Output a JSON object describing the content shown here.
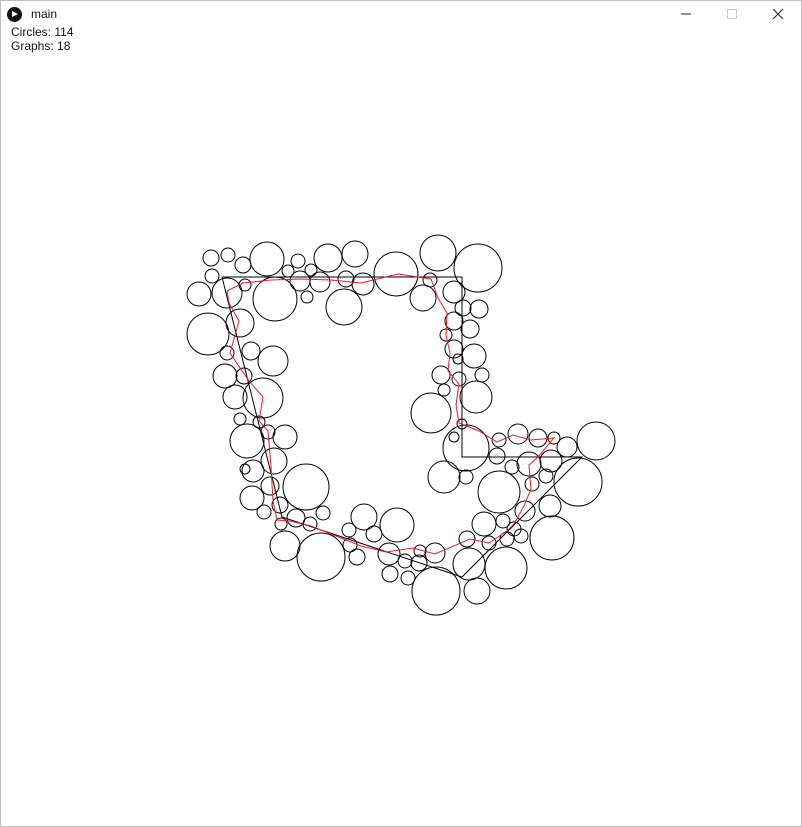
{
  "window": {
    "title": "main",
    "controls": {
      "minimize_icon": "minimize-icon",
      "maximize_icon": "maximize-icon",
      "close_icon": "close-icon"
    }
  },
  "stats": {
    "circles_label": "Circles:",
    "circles_value": "114",
    "graphs_label": "Graphs:",
    "graphs_value": "18"
  },
  "colors": {
    "outline": "#000000",
    "path": "#e02020",
    "background": "#ffffff"
  }
}
